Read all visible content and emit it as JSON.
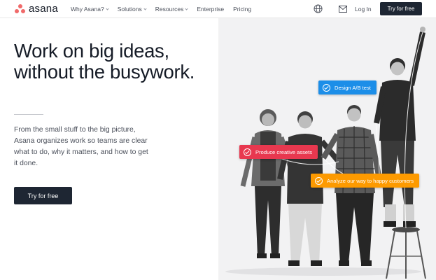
{
  "brand": {
    "name": "asana",
    "color": "#f06a6a"
  },
  "nav": {
    "items": [
      {
        "label": "Why Asana?",
        "dropdown": true
      },
      {
        "label": "Solutions",
        "dropdown": true
      },
      {
        "label": "Resources",
        "dropdown": true
      },
      {
        "label": "Enterprise",
        "dropdown": false
      },
      {
        "label": "Pricing",
        "dropdown": false
      }
    ],
    "icons": [
      "globe-icon",
      "mail-icon"
    ],
    "login_label": "Log In",
    "cta_label": "Try for free"
  },
  "hero": {
    "headline_line1": "Work on big ideas,",
    "headline_line2": "without the busywork.",
    "body": "From the small stuff to the big picture, Asana organizes work so teams are clear what to do, why it matters, and how to get it done.",
    "cta_label": "Try for free"
  },
  "tags": [
    {
      "label": "Design A/B test",
      "color": "#1c8ee8"
    },
    {
      "label": "Produce creative assets",
      "color": "#e8384f"
    },
    {
      "label": "Analyze our way to happy customers",
      "color": "#fd9a00"
    }
  ],
  "colors": {
    "dark_button": "#1e2633",
    "text": "#151b26",
    "muted_text": "#4a4f5a"
  }
}
